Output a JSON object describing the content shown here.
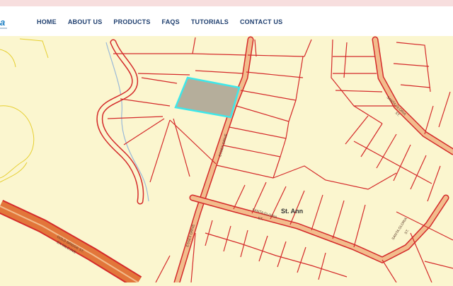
{
  "logo_text": "a",
  "nav": [
    "HOME",
    "ABOUT US",
    "PRODUCTS",
    "FAQS",
    "TUTORIALS",
    "CONTACT US"
  ],
  "map": {
    "place_label": "St. Ann",
    "road_labels": {
      "santa_gloria_1": "SANTA GLORIA",
      "santa_gloria_2": "SANTA GLORIA",
      "santa_gloria_3": "SANTA GLORIA",
      "sub_1": "ST.",
      "sub_2": "ST.",
      "sub_3": "ST.",
      "drive_1": "ESSEX DRIVE",
      "drive_2": "ESSEX DRIVE",
      "road_1": "GOLD BRIDGE ST.",
      "road_2": "EX MILE AVE"
    },
    "colors": {
      "background": "#fbf6cf",
      "parcel_lines": "#d42a2a",
      "roads": "#f2bc8c",
      "highway": "#e2763a",
      "highlight_fill": "#b5ae9b",
      "highlight_border": "#3ee7ea",
      "stream": "#9ab9d8",
      "yellow_lines": "#e6cf32"
    }
  }
}
